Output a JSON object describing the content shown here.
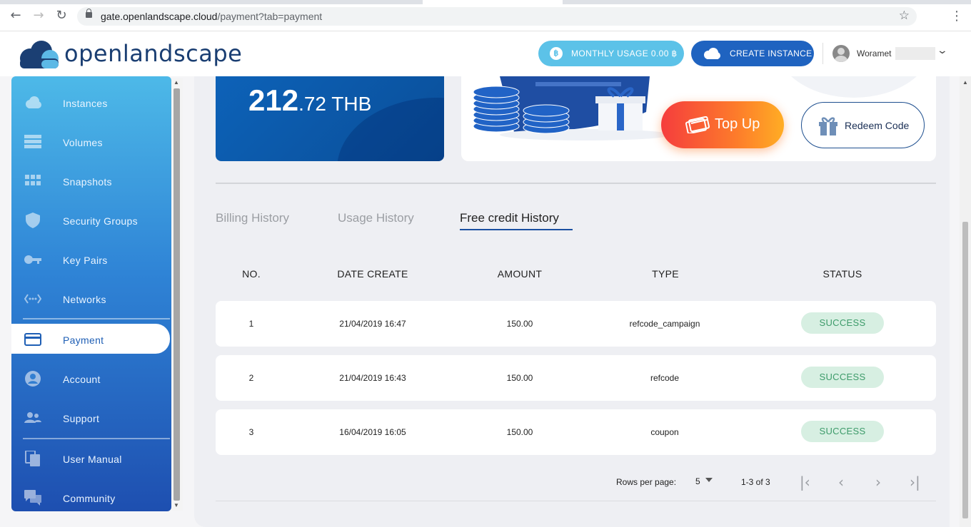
{
  "browser": {
    "url_host": "gate.openlandscape.cloud",
    "url_path": "/payment?tab=payment"
  },
  "header": {
    "brand": "openlandscape",
    "usage_label": "MONTHLY USAGE 0.00 ฿",
    "usage_coin": "฿",
    "create_label": "CREATE INSTANCE",
    "username": "Woramet"
  },
  "sidebar": {
    "items": [
      {
        "label": "Instances",
        "icon": "cloud-icon"
      },
      {
        "label": "Volumes",
        "icon": "volumes-icon"
      },
      {
        "label": "Snapshots",
        "icon": "grid-icon"
      },
      {
        "label": "Security Groups",
        "icon": "shield-icon"
      },
      {
        "label": "Key Pairs",
        "icon": "key-icon"
      },
      {
        "label": "Networks",
        "icon": "network-icon"
      },
      {
        "label": "Payment",
        "icon": "credit-card-icon"
      },
      {
        "label": "Account",
        "icon": "account-icon"
      },
      {
        "label": "Support",
        "icon": "support-icon"
      },
      {
        "label": "User Manual",
        "icon": "document-icon"
      },
      {
        "label": "Community",
        "icon": "chat-icon"
      }
    ],
    "active": "Payment"
  },
  "balance": {
    "integer": "212",
    "decimal": ".72 THB"
  },
  "actions": {
    "topup": "Top Up",
    "redeem": "Redeem Code"
  },
  "tabs": [
    {
      "label": "Billing History"
    },
    {
      "label": "Usage History"
    },
    {
      "label": "Free credit History"
    }
  ],
  "table": {
    "headers": [
      "NO.",
      "DATE CREATE",
      "AMOUNT",
      "TYPE",
      "STATUS"
    ],
    "rows": [
      {
        "no": "1",
        "date": "21/04/2019 16:47",
        "amount": "150.00",
        "type": "refcode_campaign",
        "status": "SUCCESS"
      },
      {
        "no": "2",
        "date": "21/04/2019 16:43",
        "amount": "150.00",
        "type": "refcode",
        "status": "SUCCESS"
      },
      {
        "no": "3",
        "date": "16/04/2019 16:05",
        "amount": "150.00",
        "type": "coupon",
        "status": "SUCCESS"
      }
    ]
  },
  "pagination": {
    "rows_per_page_label": "Rows per page:",
    "rows_per_page_value": "5",
    "range": "1-3 of 3"
  },
  "colors": {
    "accent": "#1f63c0",
    "usage": "#5cc2e8",
    "success_bg": "#d7efe2",
    "success_text": "#3d9b6a"
  }
}
